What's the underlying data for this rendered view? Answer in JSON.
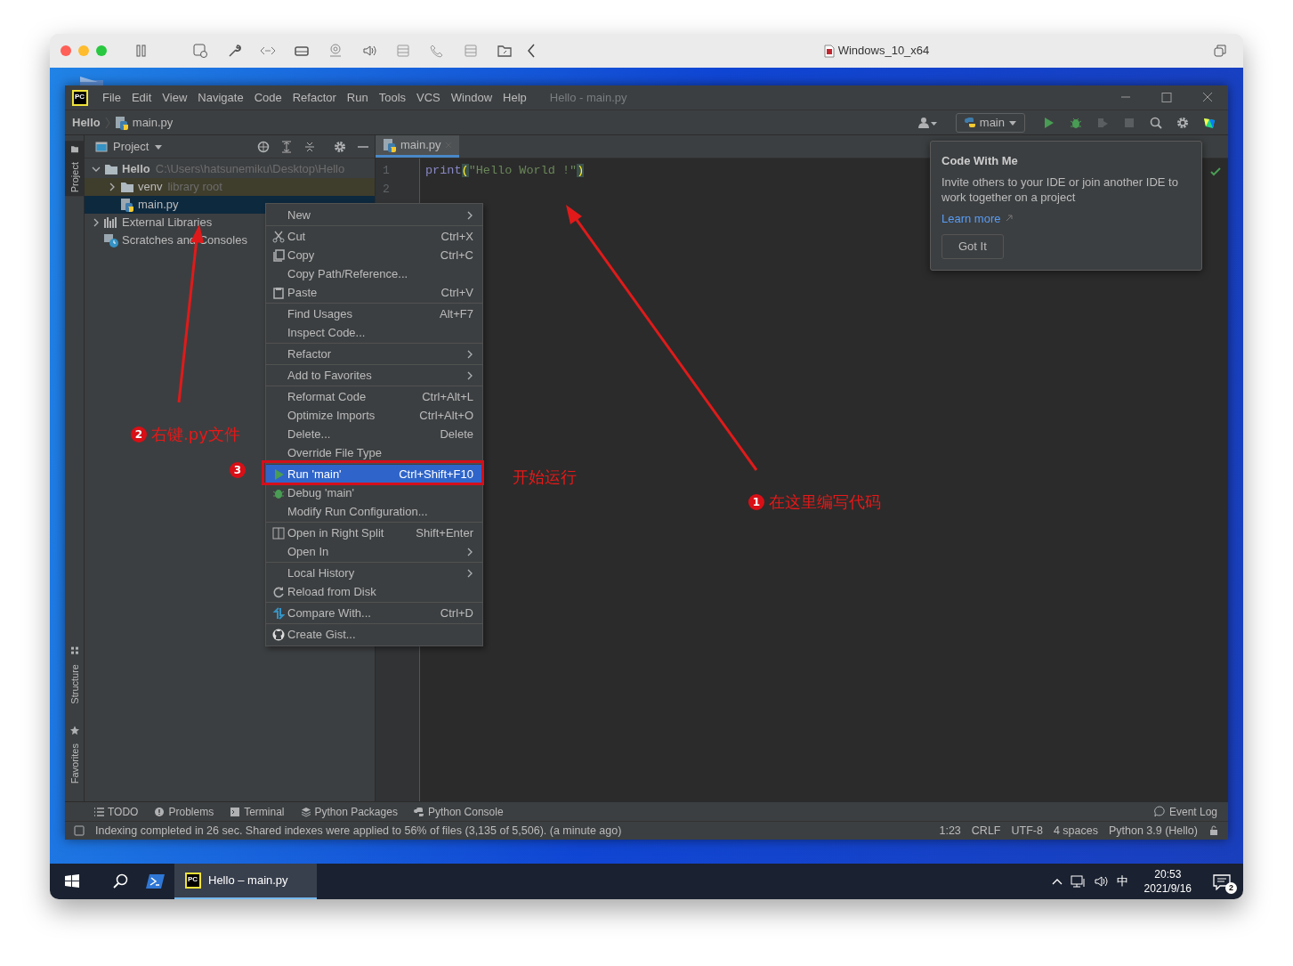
{
  "host_window": {
    "title": "Windows_10_x64"
  },
  "ide": {
    "logo": "PC",
    "menu": [
      "File",
      "Edit",
      "View",
      "Navigate",
      "Code",
      "Refactor",
      "Run",
      "Tools",
      "VCS",
      "Window",
      "Help"
    ],
    "window_title": "Hello - main.py",
    "breadcrumb": [
      "Hello",
      "main.py"
    ],
    "run_config": "main",
    "side_tabs": {
      "top": [
        {
          "label": "Project",
          "selected": true,
          "kind": "project"
        }
      ],
      "bottom": [
        {
          "label": "Structure",
          "selected": false,
          "kind": "structure"
        },
        {
          "label": "Favorites",
          "selected": false,
          "kind": "favorites"
        }
      ]
    },
    "project_panel": {
      "title": "Project",
      "tree": [
        {
          "label": "Hello",
          "hint": "C:\\Users\\hatsunemiku\\Desktop\\Hello",
          "kind": "project",
          "expanded": true,
          "selected": false,
          "highlighted": false,
          "children": [
            {
              "label": "venv",
              "hint": "library root",
              "kind": "folder",
              "expanded": false,
              "selected": false,
              "highlighted": true
            },
            {
              "label": "main.py",
              "kind": "python-file",
              "selected": true,
              "highlighted": false
            }
          ]
        },
        {
          "label": "External Libraries",
          "kind": "libraries",
          "expanded": false,
          "selected": false,
          "highlighted": false
        },
        {
          "label": "Scratches and Consoles",
          "kind": "scratches",
          "selected": false,
          "highlighted": false
        }
      ]
    },
    "editor": {
      "tabs": [
        {
          "label": "main.py",
          "selected": true
        }
      ],
      "lines": [
        {
          "number": "1",
          "tokens": [
            {
              "text": "print",
              "kind": "builtin"
            },
            {
              "text": "(",
              "kind": "paren"
            },
            {
              "text": "\"Hello World !\"",
              "kind": "string"
            },
            {
              "text": ")",
              "kind": "paren"
            }
          ]
        },
        {
          "number": "2"
        }
      ]
    },
    "context_menu": {
      "groups": [
        [
          {
            "label": "New",
            "kind": "plain",
            "submenu": true,
            "selected": false
          }
        ],
        [
          {
            "label": "Cut",
            "shortcut": "Ctrl+X",
            "kind": "cut",
            "submenu": false,
            "selected": false
          },
          {
            "label": "Copy",
            "shortcut": "Ctrl+C",
            "kind": "copy",
            "submenu": false,
            "selected": false
          },
          {
            "label": "Copy Path/Reference...",
            "kind": "plain",
            "submenu": false,
            "selected": false
          },
          {
            "label": "Paste",
            "shortcut": "Ctrl+V",
            "kind": "paste",
            "submenu": false,
            "selected": false
          }
        ],
        [
          {
            "label": "Find Usages",
            "shortcut": "Alt+F7",
            "kind": "plain",
            "submenu": false,
            "selected": false
          },
          {
            "label": "Inspect Code...",
            "kind": "plain",
            "submenu": false,
            "selected": false
          }
        ],
        [
          {
            "label": "Refactor",
            "kind": "plain",
            "submenu": true,
            "selected": false
          }
        ],
        [
          {
            "label": "Add to Favorites",
            "kind": "plain",
            "submenu": true,
            "selected": false
          }
        ],
        [
          {
            "label": "Reformat Code",
            "shortcut": "Ctrl+Alt+L",
            "kind": "plain",
            "submenu": false,
            "selected": false
          },
          {
            "label": "Optimize Imports",
            "shortcut": "Ctrl+Alt+O",
            "kind": "plain",
            "submenu": false,
            "selected": false
          },
          {
            "label": "Delete...",
            "shortcut": "Delete",
            "kind": "plain",
            "submenu": false,
            "selected": false
          },
          {
            "label": "Override File Type",
            "kind": "plain",
            "submenu": false,
            "selected": false
          }
        ],
        [
          {
            "label": "Run 'main'",
            "shortcut": "Ctrl+Shift+F10",
            "kind": "run",
            "submenu": false,
            "selected": true
          },
          {
            "label": "Debug 'main'",
            "kind": "debug",
            "submenu": false,
            "selected": false
          },
          {
            "label": "Modify Run Configuration...",
            "kind": "plain",
            "submenu": false,
            "selected": false
          }
        ],
        [
          {
            "label": "Open in Right Split",
            "shortcut": "Shift+Enter",
            "kind": "split",
            "submenu": false,
            "selected": false
          },
          {
            "label": "Open In",
            "kind": "plain",
            "submenu": true,
            "selected": false
          }
        ],
        [
          {
            "label": "Local History",
            "kind": "plain",
            "submenu": true,
            "selected": false
          },
          {
            "label": "Reload from Disk",
            "kind": "reload",
            "submenu": false,
            "selected": false
          }
        ],
        [
          {
            "label": "Compare With...",
            "shortcut": "Ctrl+D",
            "kind": "compare",
            "submenu": false,
            "selected": false
          }
        ],
        [
          {
            "label": "Create Gist...",
            "kind": "gist",
            "submenu": false,
            "selected": false
          }
        ]
      ]
    },
    "popup": {
      "title": "Code With Me",
      "text": "Invite others to your IDE or join another IDE to work together on a project",
      "link": "Learn more",
      "button": "Got It"
    },
    "tool_windows": [
      {
        "label": "TODO",
        "kind": "todo"
      },
      {
        "label": "Problems",
        "kind": "problems"
      },
      {
        "label": "Terminal",
        "kind": "terminal"
      },
      {
        "label": "Python Packages",
        "kind": "packages"
      },
      {
        "label": "Python Console",
        "kind": "console"
      }
    ],
    "event_log": "Event Log",
    "status_bar": {
      "message": "Indexing completed in 26 sec. Shared indexes were applied to 56% of files (3,135 of 5,506). (a minute ago)",
      "items": [
        "1:23",
        "CRLF",
        "UTF-8",
        "4 spaces",
        "Python 3.9 (Hello)"
      ]
    }
  },
  "annotations": [
    {
      "kind": "callout",
      "number": "2",
      "text": "右键.py文件"
    },
    {
      "kind": "badge",
      "number": "3"
    },
    {
      "kind": "label",
      "text": "开始运行"
    },
    {
      "kind": "callout",
      "number": "1",
      "text": "在这里编写代码"
    }
  ],
  "taskbar": {
    "logo": "PC",
    "app": "Hello – main.py",
    "ime": "中",
    "time": "20:53",
    "date": "2021/9/16",
    "notifications": "2"
  }
}
